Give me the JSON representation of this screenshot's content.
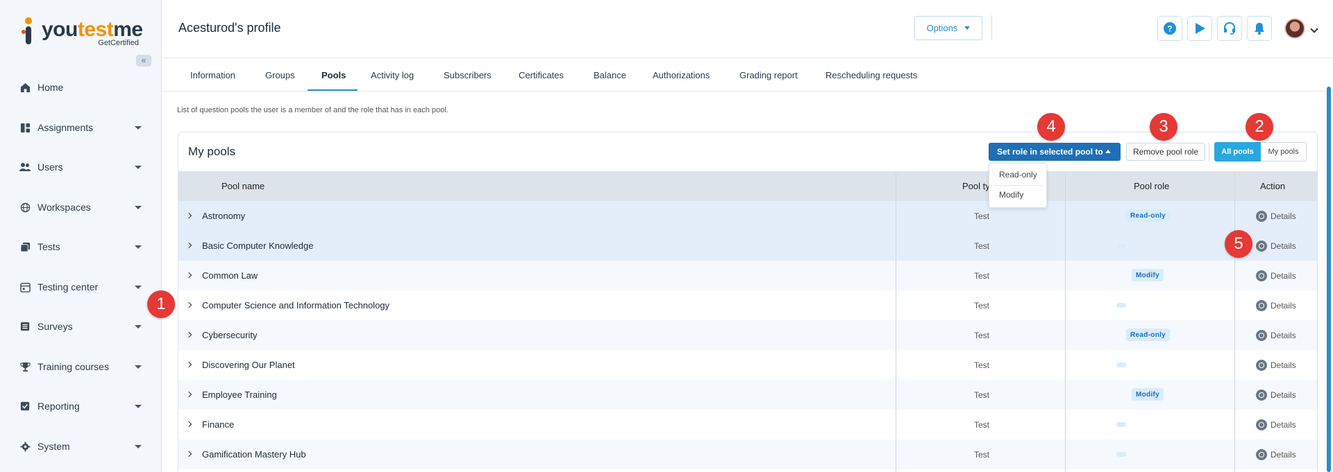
{
  "brand": {
    "name_part1": "you",
    "name_accent": "test",
    "name_part2": "me",
    "subtitle": "GetCertified"
  },
  "sidebar": {
    "collapse_icon": "double-chevron-left-icon",
    "items": [
      {
        "label": "Home",
        "icon": "home-icon",
        "has_caret": false
      },
      {
        "label": "Assignments",
        "icon": "dashboard-icon",
        "has_caret": true
      },
      {
        "label": "Users",
        "icon": "users-icon",
        "has_caret": true
      },
      {
        "label": "Workspaces",
        "icon": "globe-icon",
        "has_caret": true
      },
      {
        "label": "Tests",
        "icon": "tests-icon",
        "has_caret": true
      },
      {
        "label": "Testing center",
        "icon": "calendar-icon",
        "has_caret": true
      },
      {
        "label": "Surveys",
        "icon": "list-icon",
        "has_caret": true
      },
      {
        "label": "Training courses",
        "icon": "trophy-icon",
        "has_caret": true
      },
      {
        "label": "Reporting",
        "icon": "report-icon",
        "has_caret": true
      },
      {
        "label": "System",
        "icon": "gear-icon",
        "has_caret": true
      }
    ]
  },
  "header": {
    "title": "Acesturod's profile",
    "options_label": "Options",
    "icons": [
      "help-icon",
      "play-icon",
      "headset-icon",
      "bell-icon"
    ]
  },
  "tabs": [
    {
      "label": "Information",
      "active": false
    },
    {
      "label": "Groups",
      "active": false
    },
    {
      "label": "Pools",
      "active": true
    },
    {
      "label": "Activity log",
      "active": false
    },
    {
      "label": "Subscribers",
      "active": false
    },
    {
      "label": "Certificates",
      "active": false
    },
    {
      "label": "Balance",
      "active": false
    },
    {
      "label": "Authorizations",
      "active": false
    },
    {
      "label": "Grading report",
      "active": false
    },
    {
      "label": "Rescheduling requests",
      "active": false
    }
  ],
  "main": {
    "description": "List of question pools the user is a member of and the role that has in each pool.",
    "panel_title": "My pools",
    "set_role_label": "Set role in selected pool to",
    "remove_role_label": "Remove pool role",
    "filter": {
      "all_label": "All pools",
      "my_label": "My pools",
      "selected": "All pools"
    },
    "dropdown_options": [
      "Read-only",
      "Modify"
    ],
    "columns": [
      "Pool name",
      "Pool ty",
      "Pool role",
      "Action"
    ],
    "rows": [
      {
        "name": "Astronomy",
        "type": "Test",
        "role": "Read-only",
        "action": "Details",
        "selected": true
      },
      {
        "name": "Basic Computer Knowledge",
        "type": "Test",
        "role": "",
        "action": "Details",
        "selected": true
      },
      {
        "name": "Common Law",
        "type": "Test",
        "role": "Modify",
        "action": "Details",
        "selected": false
      },
      {
        "name": "Computer Science and Information Technology",
        "type": "Test",
        "role": "",
        "action": "Details",
        "selected": false
      },
      {
        "name": "Cybersecurity",
        "type": "Test",
        "role": "Read-only",
        "action": "Details",
        "selected": false
      },
      {
        "name": "Discovering Our Planet",
        "type": "Test",
        "role": "",
        "action": "Details",
        "selected": false
      },
      {
        "name": "Employee Training",
        "type": "Test",
        "role": "Modify",
        "action": "Details",
        "selected": false
      },
      {
        "name": "Finance",
        "type": "Test",
        "role": "",
        "action": "Details",
        "selected": false
      },
      {
        "name": "Gamification Mastery Hub",
        "type": "Test",
        "role": "",
        "action": "Details",
        "selected": false
      }
    ]
  },
  "callouts": [
    "1",
    "2",
    "3",
    "4",
    "5"
  ],
  "colors": {
    "primary": "#1e6fb5",
    "accent": "#29a8e0",
    "callout": "#e53935",
    "brand_orange": "#f39200"
  }
}
